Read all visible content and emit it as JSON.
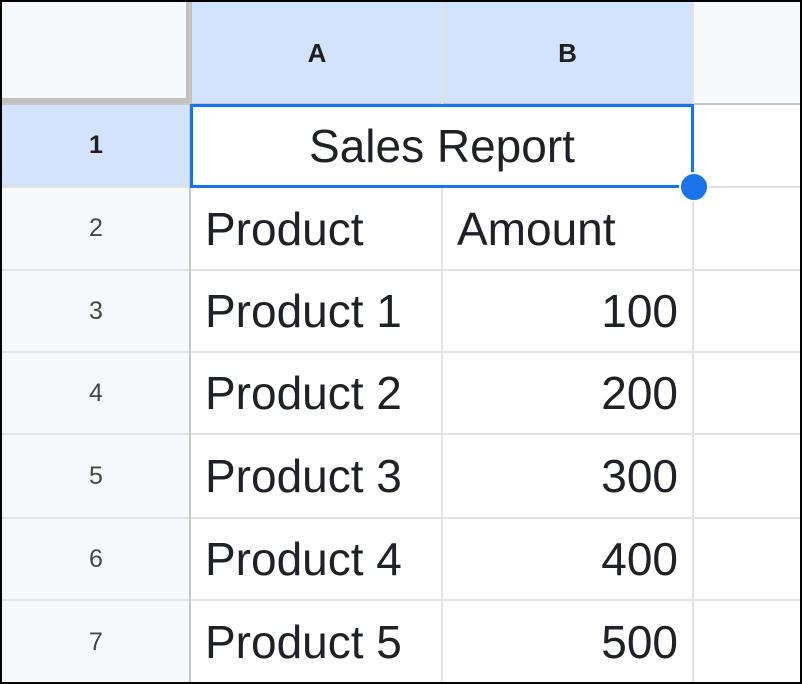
{
  "sheet": {
    "columns": [
      "A",
      "B"
    ],
    "rows": [
      "1",
      "2",
      "3",
      "4",
      "5",
      "6",
      "7"
    ],
    "title_cell": "Sales Report",
    "headers": [
      "Product",
      "Amount"
    ],
    "data": [
      [
        "Product 1",
        "100"
      ],
      [
        "Product 2",
        "200"
      ],
      [
        "Product 3",
        "300"
      ],
      [
        "Product 4",
        "400"
      ],
      [
        "Product 5",
        "500"
      ]
    ],
    "selected_range": "A1:B1"
  },
  "colors": {
    "selection": "#1a73e8",
    "header_selected": "#d3e3fd"
  }
}
